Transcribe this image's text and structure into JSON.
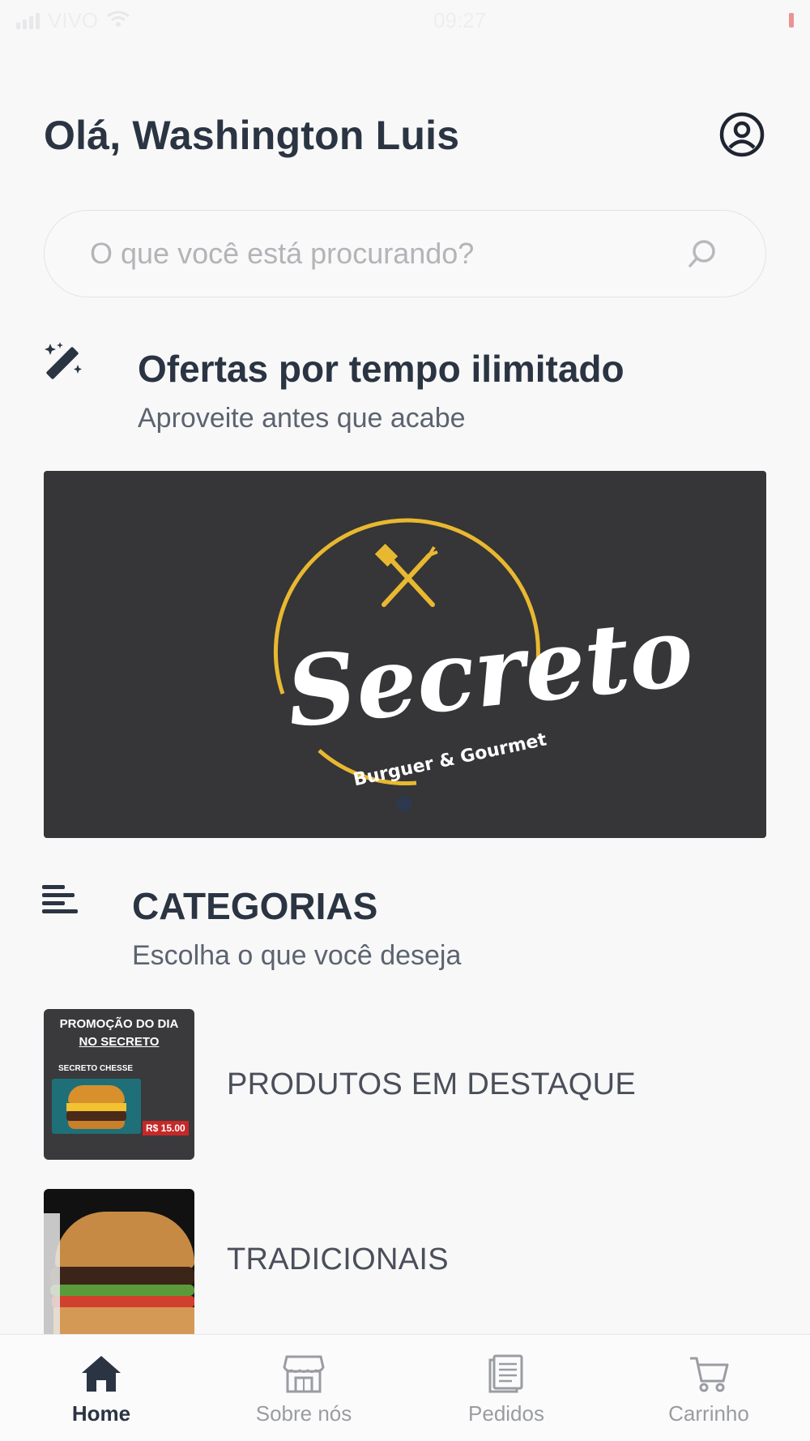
{
  "status_bar": {
    "carrier": "VIVO",
    "time": "09:27"
  },
  "header": {
    "greeting": "Olá, Washington Luis"
  },
  "search": {
    "placeholder": "O que você está procurando?"
  },
  "offers": {
    "title": "Ofertas por tempo ilimitado",
    "subtitle": "Aproveite antes que acabe",
    "banner": {
      "brand": "Secreto",
      "tagline": "Burguer & Gourmet",
      "accent_color": "#e8b830",
      "background_color": "#363537"
    }
  },
  "categories": {
    "title": "CATEGORIAS",
    "subtitle": "Escolha o que você deseja",
    "items": [
      {
        "label": "PRODUTOS EM DESTAQUE",
        "thumb": {
          "headline_1": "PROMOÇÃO DO DIA",
          "headline_2": "NO SECRETO",
          "product": "SECRETO CHESSE",
          "price": "R$ 15.00"
        }
      },
      {
        "label": "TRADICIONAIS"
      }
    ]
  },
  "bottom_nav": {
    "items": [
      {
        "label": "Home",
        "icon": "home-icon",
        "active": true
      },
      {
        "label": "Sobre nós",
        "icon": "store-icon",
        "active": false
      },
      {
        "label": "Pedidos",
        "icon": "orders-icon",
        "active": false
      },
      {
        "label": "Carrinho",
        "icon": "cart-icon",
        "active": false
      }
    ]
  }
}
